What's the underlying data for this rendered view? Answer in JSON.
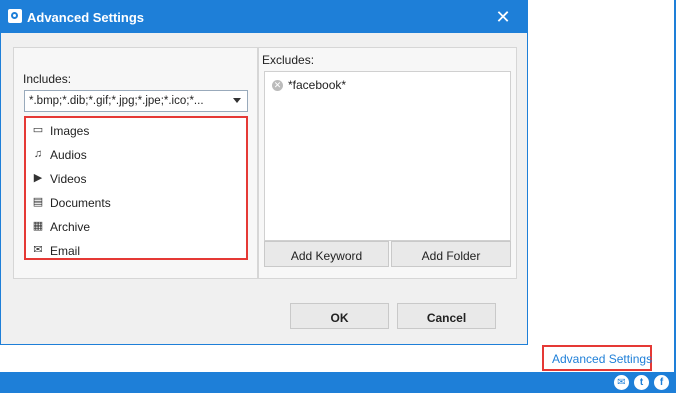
{
  "dialog": {
    "title": "Advanced Settings",
    "close_glyph": "✕"
  },
  "includes": {
    "label": "Includes:",
    "selected_value": "*.bmp;*.dib;*.gif;*.jpg;*.jpe;*.ico;*...",
    "options": [
      {
        "label": "Images",
        "icon": "image-icon",
        "glyph": "▭"
      },
      {
        "label": "Audios",
        "icon": "music-note-icon",
        "glyph": "♫"
      },
      {
        "label": "Videos",
        "icon": "video-camera-icon",
        "glyph": "▶"
      },
      {
        "label": "Documents",
        "icon": "document-icon",
        "glyph": "▤"
      },
      {
        "label": "Archive",
        "icon": "archive-icon",
        "glyph": "▦"
      },
      {
        "label": "Email",
        "icon": "envelope-icon",
        "glyph": "✉"
      }
    ]
  },
  "excludes": {
    "label": "Excludes:",
    "items": [
      {
        "label": "*facebook*",
        "remove_glyph": "✕"
      }
    ],
    "add_keyword_label": "Add Keyword",
    "add_folder_label": "Add Folder"
  },
  "footer": {
    "ok_label": "OK",
    "cancel_label": "Cancel"
  },
  "app": {
    "advanced_settings_link": "Advanced Settings",
    "social_icons": [
      {
        "name": "email-icon",
        "glyph": "✉"
      },
      {
        "name": "twitter-icon",
        "glyph": "t"
      },
      {
        "name": "facebook-icon",
        "glyph": "f"
      }
    ]
  },
  "colors": {
    "accent": "#1e7fd8",
    "highlight_border": "#e53935"
  }
}
